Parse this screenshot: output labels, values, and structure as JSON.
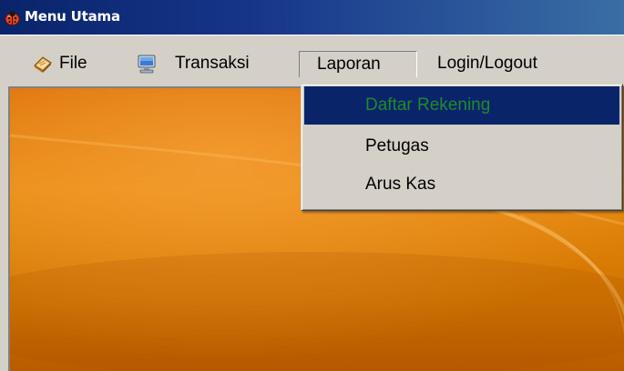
{
  "window": {
    "title": "Menu Utama",
    "title_icon": "ladybug-icon"
  },
  "menubar": {
    "items": [
      {
        "label": "File",
        "icon": "book-icon"
      },
      {
        "label": "Transaksi",
        "icon": "computer-icon"
      },
      {
        "label": "Laporan",
        "icon": null,
        "state": "open"
      },
      {
        "label": "Login/Logout",
        "icon": null
      }
    ]
  },
  "laporan_menu": {
    "items": [
      {
        "label": "Daftar Rekening",
        "highlighted": true
      },
      {
        "label": "Petugas",
        "highlighted": false
      },
      {
        "label": "Arus Kas",
        "highlighted": false
      }
    ]
  },
  "colors": {
    "titlebar": "#0a246a",
    "menu_background": "#d4d0c8",
    "highlight_background": "#0a246a",
    "highlight_text": "#1f8a2a",
    "wallpaper_orange": "#e07a00"
  }
}
